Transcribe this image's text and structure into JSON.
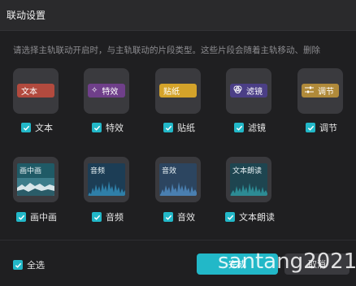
{
  "dialog": {
    "title": "联动设置",
    "description": "请选择主轨联动开启时，与主轨联动的片段类型。这些片段会随着主轨移动、删除"
  },
  "row1": [
    {
      "tile_label": "文本",
      "check_label": "文本",
      "checked": true,
      "icon": "text-icon"
    },
    {
      "tile_label": "特效",
      "check_label": "特效",
      "checked": true,
      "icon": "sparkle-icon"
    },
    {
      "tile_label": "贴纸",
      "check_label": "贴纸",
      "checked": true,
      "icon": "sticker-icon"
    },
    {
      "tile_label": "滤镜",
      "check_label": "滤镜",
      "checked": true,
      "icon": "filter-icon"
    },
    {
      "tile_label": "调节",
      "check_label": "调节",
      "checked": true,
      "icon": "adjust-icon"
    }
  ],
  "row2": [
    {
      "tile_label": "画中画",
      "check_label": "画中画",
      "checked": true
    },
    {
      "tile_label": "音频",
      "check_label": "音频",
      "checked": true
    },
    {
      "tile_label": "音效",
      "check_label": "音效",
      "checked": true
    },
    {
      "tile_label": "文本朗读",
      "check_label": "文本朗读",
      "checked": true
    }
  ],
  "footer": {
    "select_all_label": "全选",
    "select_all_checked": true,
    "ok_label": "完成",
    "cancel_label": "取消"
  },
  "watermark": "santang2021",
  "colors": {
    "accent": "#22b8c8",
    "background": "#1f1f21"
  }
}
